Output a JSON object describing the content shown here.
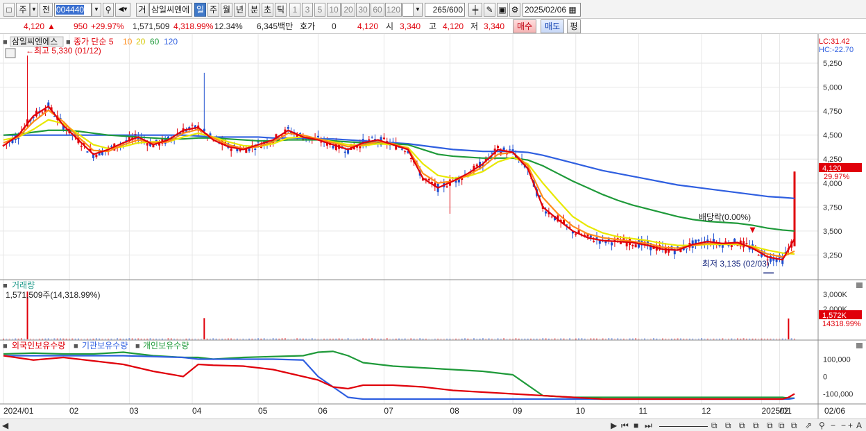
{
  "toolbar": {
    "period_d": "주",
    "prev_label": "전",
    "code": "004440",
    "trade_label": "거",
    "stock_name": "삼일씨엔에",
    "periods": [
      "일",
      "주",
      "월",
      "년",
      "분",
      "초",
      "틱"
    ],
    "selected_period": "일",
    "counts": [
      "1",
      "3",
      "5",
      "10",
      "20",
      "30",
      "60",
      "120"
    ],
    "range_shown": "265",
    "range_total": "/600",
    "date": "2025/02/06"
  },
  "quote": {
    "price": "4,120",
    "change": "950",
    "change_pct": "+29.97%",
    "volume": "1,571,509",
    "volume_pct": "4,318.99%",
    "turnover": "12.34%",
    "amount": "6,345백만",
    "hoga_label": "호가",
    "hoga_value": "0",
    "cur_price": "4,120",
    "open_label": "시",
    "open": "3,340",
    "high_label": "고",
    "high": "4,120",
    "low_label": "저",
    "low": "3,340",
    "buy_label": "매수",
    "sell_label": "매도",
    "eval_label": "평"
  },
  "price_panel": {
    "legend_name": "삼일씨엔에스",
    "legend_items": [
      {
        "label": "종가 단순 5",
        "color": "#e0000a"
      },
      {
        "label": "10",
        "color": "#ff8c1a"
      },
      {
        "label": "20",
        "color": "#e8e800"
      },
      {
        "label": "60",
        "color": "#1f9a3a"
      },
      {
        "label": "120",
        "color": "#2f5fe0"
      }
    ],
    "high_note": "←최고 5,330 (01/12)",
    "low_note": "최저 3,135 (02/03)",
    "dividend_note": "배당락(0.00%)",
    "lc": "LC:31.42",
    "hc": "HC:-22.70",
    "price_tag": "4,120",
    "pct_tag": "29.97%"
  },
  "volume_panel": {
    "title": "거래량",
    "value_note": "1,571,509주(14,318.99%)",
    "tag": "1,572K",
    "tag_pct": "14318.99%"
  },
  "holdings_panel": {
    "legend": [
      {
        "label": "외국인보유수량",
        "color": "#e0000a"
      },
      {
        "label": "기관보유수량",
        "color": "#2f5fe0"
      },
      {
        "label": "개인보유수량",
        "color": "#1f9a3a"
      }
    ]
  },
  "x_axis": {
    "labels": [
      "2024/01",
      "02",
      "03",
      "04",
      "05",
      "06",
      "07",
      "08",
      "09",
      "10",
      "11",
      "12",
      "2025/01",
      "02"
    ],
    "last_label": "02/06"
  },
  "chart_data": [
    {
      "type": "line",
      "title": "삼일씨엔에스",
      "x": [
        0,
        5,
        10,
        15,
        20,
        25,
        30,
        35,
        40,
        45,
        50,
        55,
        60,
        65,
        70,
        75,
        80,
        85,
        90,
        95,
        100,
        105,
        110,
        115,
        120,
        125,
        130,
        135,
        140,
        145,
        150,
        155,
        160,
        165,
        170,
        175,
        180,
        185,
        190,
        195,
        200,
        205,
        210,
        215,
        220,
        225,
        230,
        235,
        240,
        245,
        250,
        255,
        260,
        264
      ],
      "ma_values": {
        "ma5": [
          4390,
          4500,
          4700,
          4800,
          4600,
          4450,
          4300,
          4350,
          4420,
          4480,
          4400,
          4450,
          4550,
          4580,
          4450,
          4380,
          4350,
          4400,
          4450,
          4550,
          4480,
          4450,
          4400,
          4350,
          4420,
          4450,
          4400,
          4350,
          4050,
          3950,
          4020,
          4100,
          4200,
          4350,
          4320,
          4150,
          3750,
          3620,
          3500,
          3430,
          3400,
          3390,
          3380,
          3350,
          3310,
          3300,
          3360,
          3390,
          3370,
          3380,
          3320,
          3230,
          3200,
          3420
        ],
        "ma10": [
          4420,
          4480,
          4640,
          4760,
          4640,
          4480,
          4340,
          4330,
          4400,
          4450,
          4420,
          4430,
          4520,
          4560,
          4470,
          4400,
          4360,
          4380,
          4430,
          4520,
          4500,
          4460,
          4420,
          4380,
          4400,
          4430,
          4410,
          4360,
          4100,
          4000,
          4020,
          4080,
          4170,
          4300,
          4320,
          4180,
          3850,
          3680,
          3550,
          3470,
          3430,
          3410,
          3390,
          3370,
          3330,
          3320,
          3350,
          3370,
          3370,
          3370,
          3330,
          3260,
          3230,
          3290
        ],
        "ma20": [
          4450,
          4480,
          4560,
          4660,
          4620,
          4510,
          4400,
          4360,
          4380,
          4420,
          4430,
          4430,
          4480,
          4520,
          4480,
          4430,
          4390,
          4380,
          4410,
          4470,
          4480,
          4460,
          4430,
          4400,
          4390,
          4410,
          4400,
          4370,
          4200,
          4080,
          4050,
          4070,
          4120,
          4220,
          4270,
          4200,
          4000,
          3820,
          3650,
          3550,
          3480,
          3440,
          3420,
          3400,
          3370,
          3350,
          3350,
          3360,
          3360,
          3360,
          3340,
          3300,
          3270,
          3260
        ],
        "ma60": [
          4500,
          4510,
          4530,
          4550,
          4550,
          4540,
          4520,
          4500,
          4490,
          4480,
          4470,
          4460,
          4460,
          4470,
          4470,
          4460,
          4450,
          4440,
          4440,
          4450,
          4450,
          4450,
          4440,
          4430,
          4420,
          4420,
          4410,
          4400,
          4350,
          4300,
          4280,
          4270,
          4260,
          4260,
          4260,
          4240,
          4180,
          4100,
          4020,
          3950,
          3880,
          3820,
          3770,
          3730,
          3690,
          3650,
          3620,
          3600,
          3590,
          3580,
          3560,
          3530,
          3510,
          3500
        ],
        "ma120": [
          4500,
          4500,
          4500,
          4500,
          4500,
          4500,
          4500,
          4500,
          4500,
          4500,
          4500,
          4500,
          4500,
          4490,
          4480,
          4480,
          4480,
          4480,
          4470,
          4470,
          4470,
          4460,
          4460,
          4450,
          4440,
          4430,
          4420,
          4410,
          4390,
          4370,
          4350,
          4340,
          4330,
          4330,
          4330,
          4320,
          4290,
          4250,
          4210,
          4170,
          4130,
          4100,
          4070,
          4040,
          4010,
          3980,
          3960,
          3940,
          3920,
          3900,
          3880,
          3860,
          3850,
          3840
        ]
      },
      "ylabel_ticks": [
        3250,
        3500,
        3750,
        4000,
        4250,
        4500,
        4750,
        5000,
        5250
      ],
      "ylim": [
        3050,
        5330
      ],
      "last_close": 4120
    },
    {
      "type": "bar",
      "title": "거래량",
      "ylabel_ticks": [
        "2,000K",
        "3,000K"
      ],
      "spikes": [
        {
          "x": 8,
          "value": 3600
        },
        {
          "x": 67,
          "value": 1600
        },
        {
          "x": 262,
          "value": 1572
        }
      ],
      "ylim": [
        0,
        3600
      ]
    },
    {
      "type": "line",
      "title": "보유수량",
      "ylabel_ticks": [
        "100,000",
        "0",
        "-100,000"
      ],
      "x": [
        0,
        10,
        20,
        30,
        40,
        50,
        60,
        65,
        70,
        80,
        90,
        100,
        105,
        110,
        115,
        120,
        130,
        140,
        150,
        160,
        170,
        180,
        190,
        200,
        210,
        220,
        230,
        240,
        250,
        255,
        260,
        262,
        264
      ],
      "series": [
        {
          "name": "외국인보유수량",
          "values": [
            120000,
            95000,
            110000,
            90000,
            70000,
            30000,
            0,
            70000,
            65000,
            60000,
            40000,
            0,
            -20000,
            -60000,
            -70000,
            -50000,
            -50000,
            -60000,
            -80000,
            -90000,
            -100000,
            -110000,
            -120000,
            -130000,
            -130000,
            -130000,
            -130000,
            -130000,
            -130000,
            -130000,
            -130000,
            -120000,
            -100000
          ]
        },
        {
          "name": "기관보유수량",
          "values": [
            120000,
            120000,
            120000,
            120000,
            120000,
            115000,
            110000,
            100000,
            100000,
            100000,
            100000,
            95000,
            0,
            -60000,
            -120000,
            -130000,
            -130000,
            -130000,
            -130000,
            -130000,
            -130000,
            -130000,
            -130000,
            -130000,
            -130000,
            -130000,
            -130000,
            -130000,
            -130000,
            -130000,
            -130000,
            -130000,
            -125000
          ]
        },
        {
          "name": "개인보유수량",
          "values": [
            130000,
            135000,
            130000,
            130000,
            140000,
            120000,
            110000,
            110000,
            100000,
            110000,
            115000,
            120000,
            140000,
            145000,
            120000,
            80000,
            60000,
            50000,
            40000,
            30000,
            10000,
            -110000,
            -120000,
            -120000,
            -120000,
            -120000,
            -120000,
            -120000,
            -120000,
            -120000,
            -120000,
            -125000,
            -125000
          ]
        }
      ],
      "ylim": [
        -150000,
        150000
      ]
    }
  ]
}
